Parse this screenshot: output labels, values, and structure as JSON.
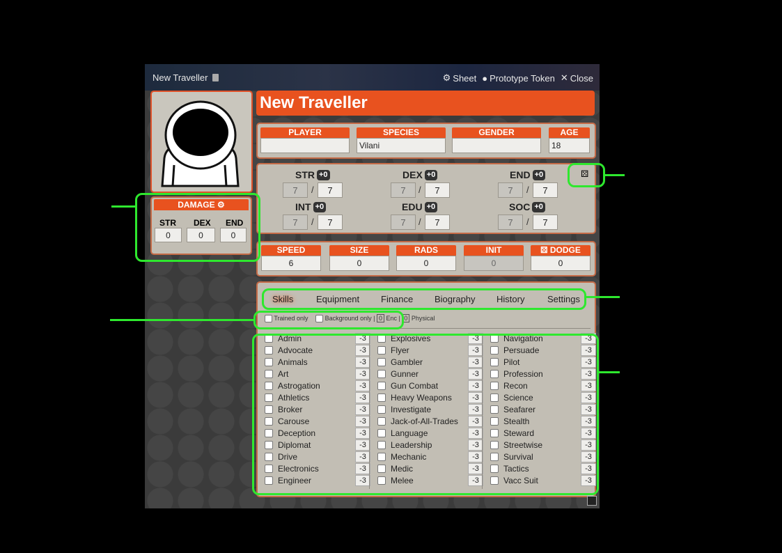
{
  "window": {
    "title": "New Traveller",
    "actions": [
      "Sheet",
      "Prototype Token",
      "Close"
    ]
  },
  "character": {
    "name": "New Traveller",
    "header_labels": [
      "PLAYER",
      "SPECIES",
      "GENDER",
      "AGE"
    ],
    "player": "",
    "species": "Vilani",
    "gender": "",
    "age": "18"
  },
  "damage": {
    "label": "DAMAGE",
    "cols": [
      "STR",
      "DEX",
      "END"
    ],
    "values": [
      "0",
      "0",
      "0"
    ]
  },
  "characteristics": [
    {
      "name": "STR",
      "mod": "+0",
      "current": "7",
      "max": "7"
    },
    {
      "name": "DEX",
      "mod": "+0",
      "current": "7",
      "max": "7"
    },
    {
      "name": "END",
      "mod": "+0",
      "current": "7",
      "max": "7"
    },
    {
      "name": "INT",
      "mod": "+0",
      "current": "7",
      "max": "7"
    },
    {
      "name": "EDU",
      "mod": "+0",
      "current": "7",
      "max": "7"
    },
    {
      "name": "SOC",
      "mod": "+0",
      "current": "7",
      "max": "7"
    }
  ],
  "derived": {
    "labels": [
      "SPEED",
      "SIZE",
      "RADS",
      "INIT",
      "DODGE"
    ],
    "values": [
      "6",
      "0",
      "0",
      "0",
      "0"
    ]
  },
  "tabs": [
    "Skills",
    "Equipment",
    "Finance",
    "Biography",
    "History",
    "Settings"
  ],
  "filters": {
    "trained_only": "Trained only",
    "background_only": "Background only |",
    "enc_value": "0",
    "enc_label": "Enc |",
    "phys_value": "0",
    "phys_label": "Physical"
  },
  "skills": {
    "col1": [
      {
        "name": "Admin",
        "val": "-3"
      },
      {
        "name": "Advocate",
        "val": "-3"
      },
      {
        "name": "Animals",
        "val": "-3"
      },
      {
        "name": "Art",
        "val": "-3"
      },
      {
        "name": "Astrogation",
        "val": "-3"
      },
      {
        "name": "Athletics",
        "val": "-3"
      },
      {
        "name": "Broker",
        "val": "-3"
      },
      {
        "name": "Carouse",
        "val": "-3"
      },
      {
        "name": "Deception",
        "val": "-3"
      },
      {
        "name": "Diplomat",
        "val": "-3"
      },
      {
        "name": "Drive",
        "val": "-3"
      },
      {
        "name": "Electronics",
        "val": "-3"
      },
      {
        "name": "Engineer",
        "val": "-3"
      }
    ],
    "col2": [
      {
        "name": "Explosives",
        "val": "-3"
      },
      {
        "name": "Flyer",
        "val": "-3"
      },
      {
        "name": "Gambler",
        "val": "-3"
      },
      {
        "name": "Gunner",
        "val": "-3"
      },
      {
        "name": "Gun Combat",
        "val": "-3"
      },
      {
        "name": "Heavy Weapons",
        "val": "-3"
      },
      {
        "name": "Investigate",
        "val": "-3"
      },
      {
        "name": "Jack-of-All-Trades",
        "val": "-3"
      },
      {
        "name": "Language",
        "val": "-3"
      },
      {
        "name": "Leadership",
        "val": "-3"
      },
      {
        "name": "Mechanic",
        "val": "-3"
      },
      {
        "name": "Medic",
        "val": "-3"
      },
      {
        "name": "Melee",
        "val": "-3"
      }
    ],
    "col3": [
      {
        "name": "Navigation",
        "val": "-3"
      },
      {
        "name": "Persuade",
        "val": "-3"
      },
      {
        "name": "Pilot",
        "val": "-3"
      },
      {
        "name": "Profession",
        "val": "-3"
      },
      {
        "name": "Recon",
        "val": "-3"
      },
      {
        "name": "Science",
        "val": "-3"
      },
      {
        "name": "Seafarer",
        "val": "-3"
      },
      {
        "name": "Stealth",
        "val": "-3"
      },
      {
        "name": "Steward",
        "val": "-3"
      },
      {
        "name": "Streetwise",
        "val": "-3"
      },
      {
        "name": "Survival",
        "val": "-3"
      },
      {
        "name": "Tactics",
        "val": "-3"
      },
      {
        "name": "Vacc Suit",
        "val": "-3"
      }
    ]
  },
  "colors": {
    "accent": "#e8521f",
    "highlight": "#2ee82e",
    "panel": "#c2beb4"
  }
}
